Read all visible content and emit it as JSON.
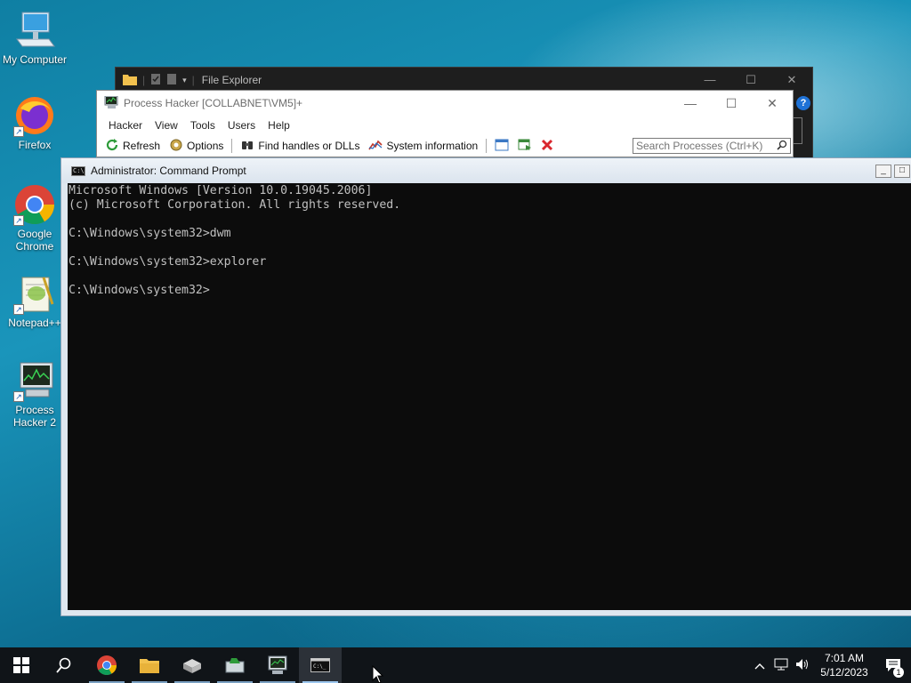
{
  "desktop": {
    "icons": [
      {
        "label": "My Computer"
      },
      {
        "label": "Firefox"
      },
      {
        "label": "Google Chrome"
      },
      {
        "label": "Notepad++"
      },
      {
        "label": "Process Hacker 2"
      }
    ]
  },
  "file_explorer": {
    "title": "File Explorer",
    "help_label": "?"
  },
  "process_hacker": {
    "title": "Process Hacker [COLLABNET\\VM5]+",
    "menu": [
      "Hacker",
      "View",
      "Tools",
      "Users",
      "Help"
    ],
    "toolbar": {
      "refresh": "Refresh",
      "options": "Options",
      "find_handles": "Find handles or DLLs",
      "system_information": "System information"
    },
    "search_placeholder": "Search Processes (Ctrl+K)"
  },
  "cmd": {
    "title": "Administrator: Command Prompt",
    "lines": [
      "Microsoft Windows [Version 10.0.19045.2006]",
      "(c) Microsoft Corporation. All rights reserved.",
      "",
      "C:\\Windows\\system32>dwm",
      "",
      "C:\\Windows\\system32>explorer",
      "",
      "C:\\Windows\\system32>"
    ]
  },
  "taskbar": {
    "time": "7:01 AM",
    "date": "5/12/2023",
    "notification_count": "1"
  },
  "colors": {
    "desktop_accent": "#1a95bb",
    "cmd_background": "#0c0c0c",
    "cmd_text": "#c0c0c0",
    "taskbar": "#101418"
  }
}
